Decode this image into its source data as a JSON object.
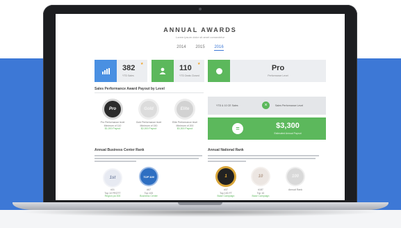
{
  "header": {
    "title": "ANNUAL AWARDS",
    "subtitle": "Lorem ipsum dolor sit amet consectetur",
    "years": [
      "2014",
      "2015",
      "2016"
    ],
    "active_year": "2016"
  },
  "stats": [
    {
      "value": "382",
      "label": "YTD Sales",
      "icon": "bar-chart-icon",
      "color": "#4a90e2"
    },
    {
      "value": "110",
      "label": "YTD Deals Closed",
      "icon": "person-icon",
      "color": "#5cb85c"
    }
  ],
  "level_card": {
    "value": "Pro",
    "label": "Performance Level",
    "icon": "circle-icon"
  },
  "sales_section": {
    "heading": "Sales Performance Award Payout by Level",
    "badges": [
      {
        "label": "Pro",
        "color": "#2b2b2b",
        "caption1": "Pro Performance level",
        "caption2": "Minimum of 110",
        "caption3": "$1,000 Payout"
      },
      {
        "label": "Gold",
        "color": "#d4d4d4",
        "caption1": "Gold Performance level",
        "caption2": "Minimum of 150",
        "caption3": "$2,000 Payout"
      },
      {
        "label": "Elite",
        "color": "#cfcfcf",
        "caption1": "Elite Performance level",
        "caption2": "Minimum of 200",
        "caption3": "$3,300 Payout"
      }
    ]
  },
  "goal_row": {
    "left_text": "YTD & 10 CE Sales",
    "right_text": "Sales Performance Level"
  },
  "payout": {
    "amount": "$3,300",
    "label": "Estimated Annual Payout"
  },
  "business_section": {
    "heading": "Annual Business Center Rank",
    "badges": [
      {
        "label": "1st",
        "color": "#e7eaf2",
        "caption1": "#31",
        "caption2": "Top 10 FROTT",
        "caption3": "Region pa 300"
      },
      {
        "label": "TOP 100",
        "color": "#2e6fc2",
        "caption1": "#67",
        "caption2": "Top 100 ",
        "caption3": "Business Center"
      }
    ]
  },
  "national_section": {
    "heading": "Annual National Rank",
    "badges": [
      {
        "label": "1",
        "color": "#222222",
        "caption1": "#37",
        "caption2": "Top 100 FT",
        "caption3": "Base Campaign"
      },
      {
        "label": "10",
        "color": "#ece6e2",
        "caption1": "#187",
        "caption2": "Top 10 ",
        "caption3": "Base Campaign"
      },
      {
        "label": "100",
        "color": "#d9d9d9",
        "caption1": "Annual Rank",
        "caption2": "",
        "caption3": ""
      }
    ]
  }
}
